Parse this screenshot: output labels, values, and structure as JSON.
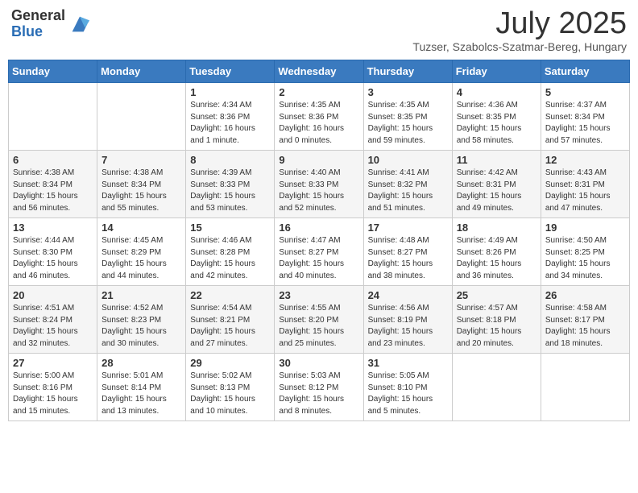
{
  "header": {
    "logo_general": "General",
    "logo_blue": "Blue",
    "month_title": "July 2025",
    "subtitle": "Tuzser, Szabolcs-Szatmar-Bereg, Hungary"
  },
  "weekdays": [
    "Sunday",
    "Monday",
    "Tuesday",
    "Wednesday",
    "Thursday",
    "Friday",
    "Saturday"
  ],
  "weeks": [
    [
      {
        "day": "",
        "sunrise": "",
        "sunset": "",
        "daylight": ""
      },
      {
        "day": "",
        "sunrise": "",
        "sunset": "",
        "daylight": ""
      },
      {
        "day": "1",
        "sunrise": "Sunrise: 4:34 AM",
        "sunset": "Sunset: 8:36 PM",
        "daylight": "Daylight: 16 hours and 1 minute."
      },
      {
        "day": "2",
        "sunrise": "Sunrise: 4:35 AM",
        "sunset": "Sunset: 8:36 PM",
        "daylight": "Daylight: 16 hours and 0 minutes."
      },
      {
        "day": "3",
        "sunrise": "Sunrise: 4:35 AM",
        "sunset": "Sunset: 8:35 PM",
        "daylight": "Daylight: 15 hours and 59 minutes."
      },
      {
        "day": "4",
        "sunrise": "Sunrise: 4:36 AM",
        "sunset": "Sunset: 8:35 PM",
        "daylight": "Daylight: 15 hours and 58 minutes."
      },
      {
        "day": "5",
        "sunrise": "Sunrise: 4:37 AM",
        "sunset": "Sunset: 8:34 PM",
        "daylight": "Daylight: 15 hours and 57 minutes."
      }
    ],
    [
      {
        "day": "6",
        "sunrise": "Sunrise: 4:38 AM",
        "sunset": "Sunset: 8:34 PM",
        "daylight": "Daylight: 15 hours and 56 minutes."
      },
      {
        "day": "7",
        "sunrise": "Sunrise: 4:38 AM",
        "sunset": "Sunset: 8:34 PM",
        "daylight": "Daylight: 15 hours and 55 minutes."
      },
      {
        "day": "8",
        "sunrise": "Sunrise: 4:39 AM",
        "sunset": "Sunset: 8:33 PM",
        "daylight": "Daylight: 15 hours and 53 minutes."
      },
      {
        "day": "9",
        "sunrise": "Sunrise: 4:40 AM",
        "sunset": "Sunset: 8:33 PM",
        "daylight": "Daylight: 15 hours and 52 minutes."
      },
      {
        "day": "10",
        "sunrise": "Sunrise: 4:41 AM",
        "sunset": "Sunset: 8:32 PM",
        "daylight": "Daylight: 15 hours and 51 minutes."
      },
      {
        "day": "11",
        "sunrise": "Sunrise: 4:42 AM",
        "sunset": "Sunset: 8:31 PM",
        "daylight": "Daylight: 15 hours and 49 minutes."
      },
      {
        "day": "12",
        "sunrise": "Sunrise: 4:43 AM",
        "sunset": "Sunset: 8:31 PM",
        "daylight": "Daylight: 15 hours and 47 minutes."
      }
    ],
    [
      {
        "day": "13",
        "sunrise": "Sunrise: 4:44 AM",
        "sunset": "Sunset: 8:30 PM",
        "daylight": "Daylight: 15 hours and 46 minutes."
      },
      {
        "day": "14",
        "sunrise": "Sunrise: 4:45 AM",
        "sunset": "Sunset: 8:29 PM",
        "daylight": "Daylight: 15 hours and 44 minutes."
      },
      {
        "day": "15",
        "sunrise": "Sunrise: 4:46 AM",
        "sunset": "Sunset: 8:28 PM",
        "daylight": "Daylight: 15 hours and 42 minutes."
      },
      {
        "day": "16",
        "sunrise": "Sunrise: 4:47 AM",
        "sunset": "Sunset: 8:27 PM",
        "daylight": "Daylight: 15 hours and 40 minutes."
      },
      {
        "day": "17",
        "sunrise": "Sunrise: 4:48 AM",
        "sunset": "Sunset: 8:27 PM",
        "daylight": "Daylight: 15 hours and 38 minutes."
      },
      {
        "day": "18",
        "sunrise": "Sunrise: 4:49 AM",
        "sunset": "Sunset: 8:26 PM",
        "daylight": "Daylight: 15 hours and 36 minutes."
      },
      {
        "day": "19",
        "sunrise": "Sunrise: 4:50 AM",
        "sunset": "Sunset: 8:25 PM",
        "daylight": "Daylight: 15 hours and 34 minutes."
      }
    ],
    [
      {
        "day": "20",
        "sunrise": "Sunrise: 4:51 AM",
        "sunset": "Sunset: 8:24 PM",
        "daylight": "Daylight: 15 hours and 32 minutes."
      },
      {
        "day": "21",
        "sunrise": "Sunrise: 4:52 AM",
        "sunset": "Sunset: 8:23 PM",
        "daylight": "Daylight: 15 hours and 30 minutes."
      },
      {
        "day": "22",
        "sunrise": "Sunrise: 4:54 AM",
        "sunset": "Sunset: 8:21 PM",
        "daylight": "Daylight: 15 hours and 27 minutes."
      },
      {
        "day": "23",
        "sunrise": "Sunrise: 4:55 AM",
        "sunset": "Sunset: 8:20 PM",
        "daylight": "Daylight: 15 hours and 25 minutes."
      },
      {
        "day": "24",
        "sunrise": "Sunrise: 4:56 AM",
        "sunset": "Sunset: 8:19 PM",
        "daylight": "Daylight: 15 hours and 23 minutes."
      },
      {
        "day": "25",
        "sunrise": "Sunrise: 4:57 AM",
        "sunset": "Sunset: 8:18 PM",
        "daylight": "Daylight: 15 hours and 20 minutes."
      },
      {
        "day": "26",
        "sunrise": "Sunrise: 4:58 AM",
        "sunset": "Sunset: 8:17 PM",
        "daylight": "Daylight: 15 hours and 18 minutes."
      }
    ],
    [
      {
        "day": "27",
        "sunrise": "Sunrise: 5:00 AM",
        "sunset": "Sunset: 8:16 PM",
        "daylight": "Daylight: 15 hours and 15 minutes."
      },
      {
        "day": "28",
        "sunrise": "Sunrise: 5:01 AM",
        "sunset": "Sunset: 8:14 PM",
        "daylight": "Daylight: 15 hours and 13 minutes."
      },
      {
        "day": "29",
        "sunrise": "Sunrise: 5:02 AM",
        "sunset": "Sunset: 8:13 PM",
        "daylight": "Daylight: 15 hours and 10 minutes."
      },
      {
        "day": "30",
        "sunrise": "Sunrise: 5:03 AM",
        "sunset": "Sunset: 8:12 PM",
        "daylight": "Daylight: 15 hours and 8 minutes."
      },
      {
        "day": "31",
        "sunrise": "Sunrise: 5:05 AM",
        "sunset": "Sunset: 8:10 PM",
        "daylight": "Daylight: 15 hours and 5 minutes."
      },
      {
        "day": "",
        "sunrise": "",
        "sunset": "",
        "daylight": ""
      },
      {
        "day": "",
        "sunrise": "",
        "sunset": "",
        "daylight": ""
      }
    ]
  ]
}
